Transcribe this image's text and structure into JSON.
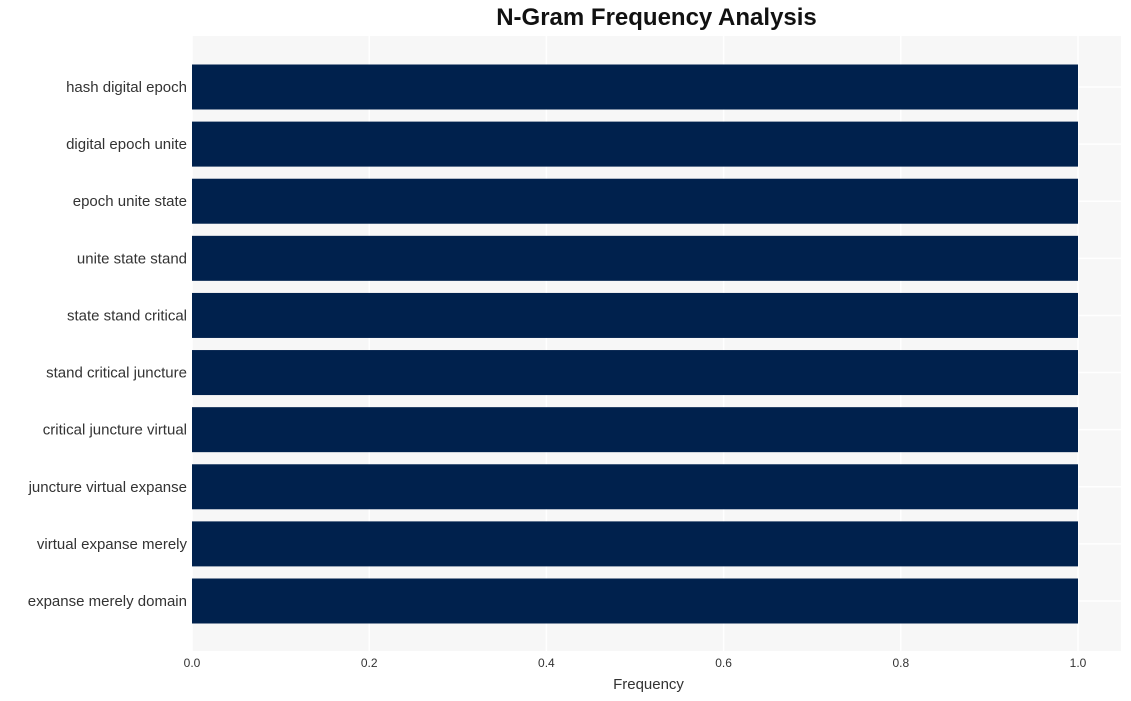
{
  "chart_data": {
    "type": "bar",
    "orientation": "horizontal",
    "title": "N-Gram Frequency Analysis",
    "xlabel": "Frequency",
    "ylabel": "",
    "categories": [
      "hash digital epoch",
      "digital epoch unite",
      "epoch unite state",
      "unite state stand",
      "state stand critical",
      "stand critical juncture",
      "critical juncture virtual",
      "juncture virtual expanse",
      "virtual expanse merely",
      "expanse merely domain"
    ],
    "values": [
      1,
      1,
      1,
      1,
      1,
      1,
      1,
      1,
      1,
      1
    ],
    "xlim": [
      0,
      1.05
    ],
    "xticks": [
      0.0,
      0.2,
      0.4,
      0.6,
      0.8,
      1.0
    ],
    "xtick_labels": [
      "0.0",
      "0.2",
      "0.4",
      "0.6",
      "0.8",
      "1.0"
    ],
    "grid": true,
    "legend": "none",
    "colors": {
      "bar": "#00214d",
      "plot_background": "#f7f7f7",
      "grid": "#ffffff"
    }
  }
}
